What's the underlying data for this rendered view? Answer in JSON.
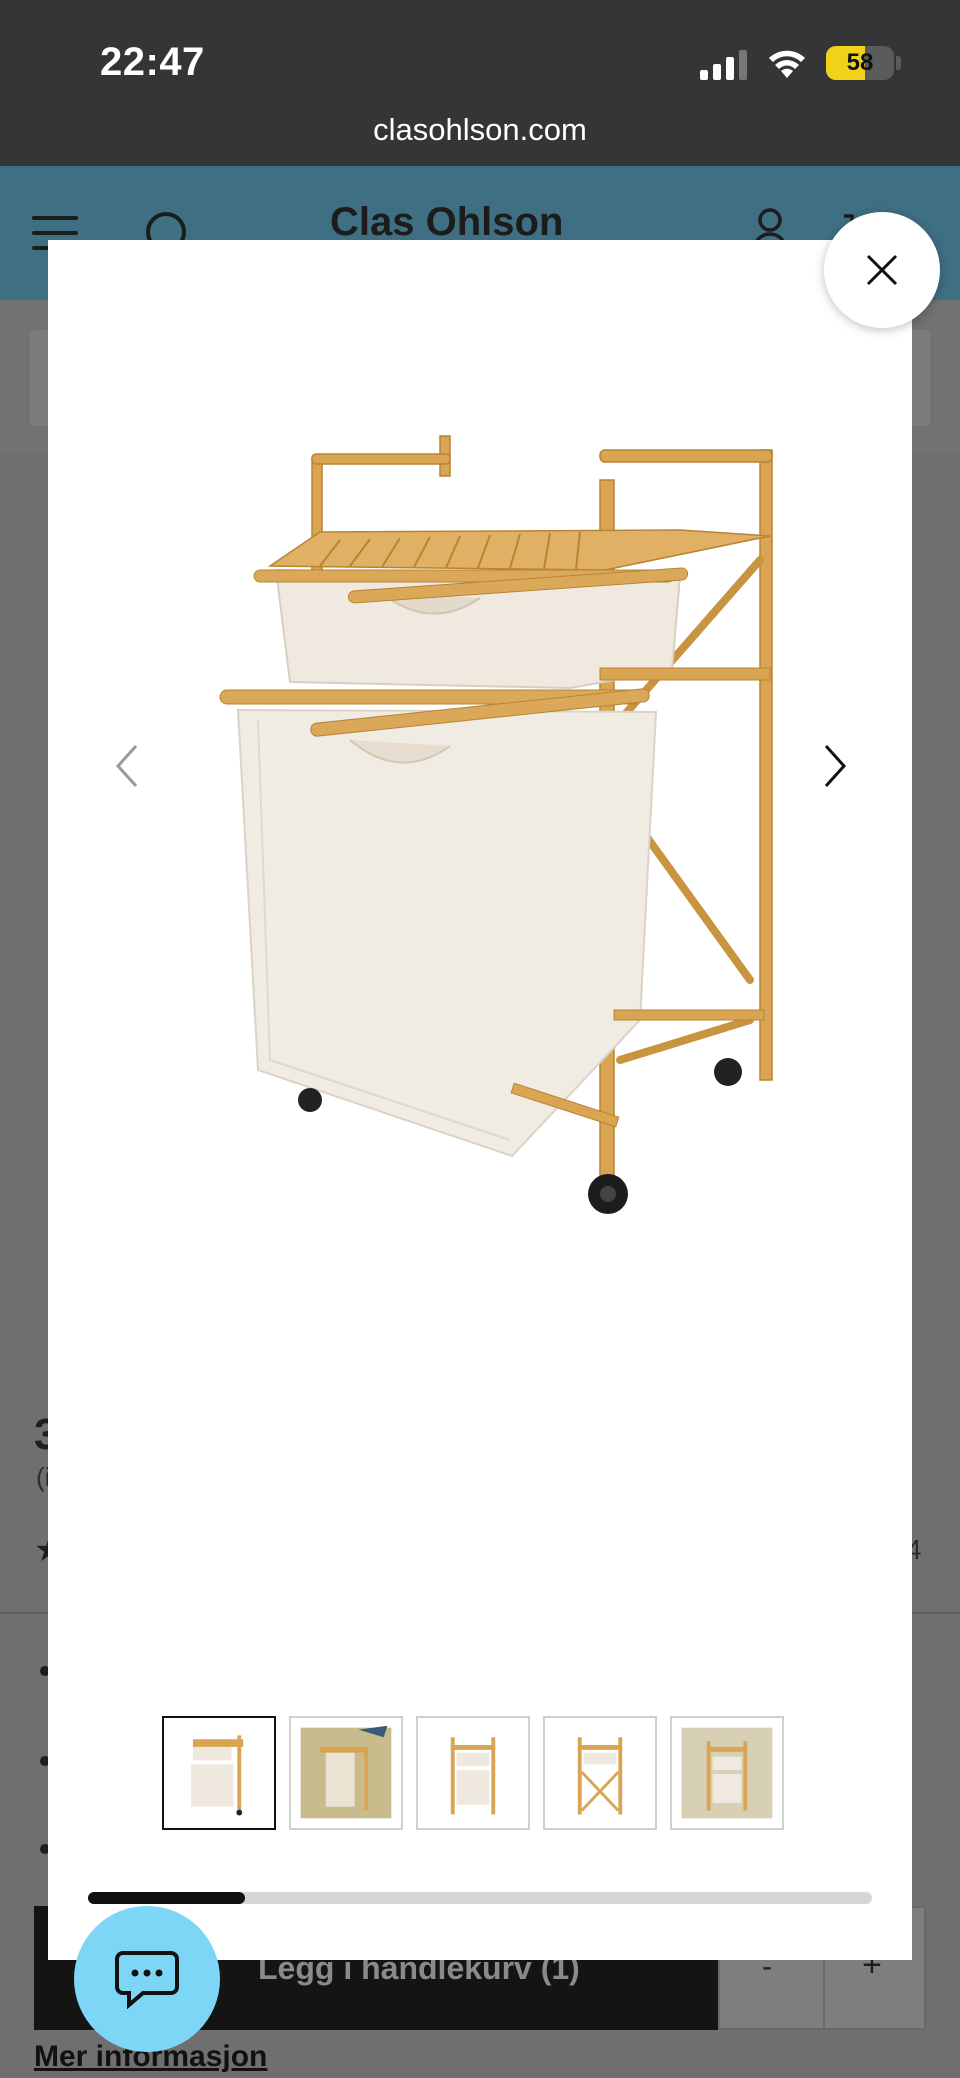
{
  "status_bar": {
    "time": "22:47",
    "battery": "58",
    "battery_level": 0.58,
    "signal_icon": "cellular-signal-icon",
    "wifi_icon": "wifi-icon"
  },
  "browser": {
    "url": "clasohlson.com"
  },
  "site_header": {
    "logo": "Clas Ohlson",
    "menu_icon": "hamburger-menu-icon",
    "search_icon": "search-icon",
    "account_icon": "user-icon",
    "cart_icon": "cart-icon"
  },
  "background_page": {
    "price_fragment": "3",
    "price_sub_fragment": "(i",
    "rating_star": "★",
    "review_count_fragment": "4",
    "add_to_cart_label": "Legg i handlekurv (1)",
    "qty_minus": "-",
    "qty_plus": "+",
    "more_info_link": "Mer informasjon"
  },
  "lightbox": {
    "close_icon": "close-icon",
    "prev_icon": "chevron-left-icon",
    "next_icon": "chevron-right-icon",
    "thumbnails": [
      {
        "name": "thumbnail-1",
        "active": true
      },
      {
        "name": "thumbnail-2",
        "active": false
      },
      {
        "name": "thumbnail-3",
        "active": false
      },
      {
        "name": "thumbnail-4",
        "active": false
      },
      {
        "name": "thumbnail-5",
        "active": false
      }
    ],
    "progress": 0.2
  },
  "chat": {
    "icon": "chat-bubble-icon",
    "color": "#7ed6f6"
  }
}
